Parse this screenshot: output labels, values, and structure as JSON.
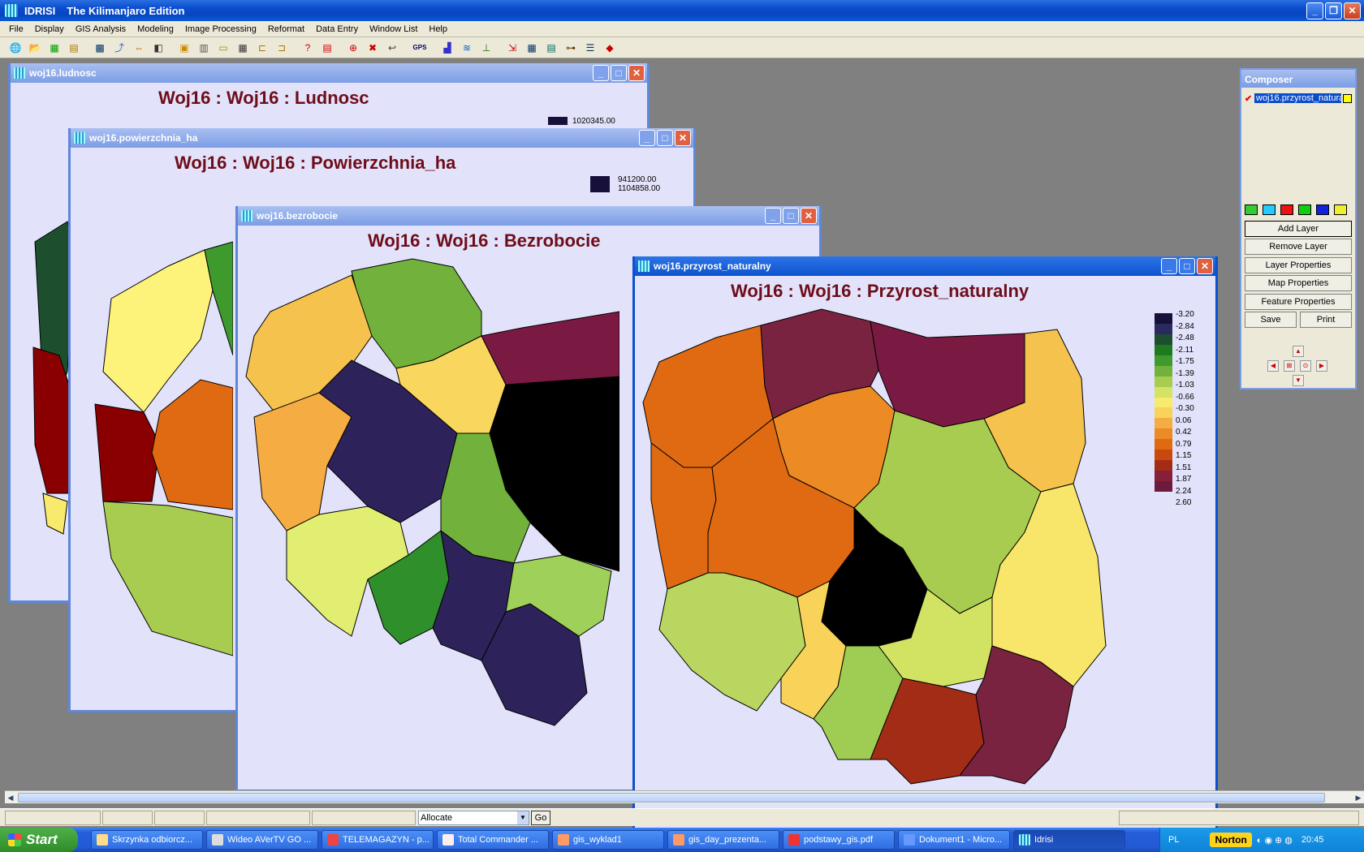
{
  "app": {
    "name": "IDRISI",
    "edition": "The Kilimanjaro Edition"
  },
  "menu": [
    "File",
    "Display",
    "GIS Analysis",
    "Modeling",
    "Image Processing",
    "Reformat",
    "Data Entry",
    "Window List",
    "Help"
  ],
  "toolbar": {
    "gps_label": "GPS"
  },
  "windows": {
    "ludnosc": {
      "title": "woj16.ludnosc",
      "map_title": "Woj16 : Woj16 : Ludnosc",
      "legend": [
        "1020345.00"
      ]
    },
    "powierzchnia": {
      "title": "woj16.powierzchnia_ha",
      "map_title": "Woj16 : Woj16 : Powierzchnia_ha",
      "legend": [
        "941200.00",
        "1104858.00"
      ]
    },
    "bezrobocie": {
      "title": "woj16.bezrobocie",
      "map_title": "Woj16 : Woj16 : Bezrobocie"
    },
    "przyrost": {
      "title": "woj16.przyrost_naturalny",
      "map_title": "Woj16 : Woj16 : Przyrost_naturalny",
      "legend": [
        "-3.20",
        "-2.84",
        "-2.48",
        "-2.11",
        "-1.75",
        "-1.39",
        "-1.03",
        "-0.66",
        "-0.30",
        "0.06",
        "0.42",
        "0.79",
        "1.15",
        "1.51",
        "1.87",
        "2.24",
        "2.60"
      ],
      "legend_colors": [
        "#16103a",
        "#2a2a60",
        "#1d4f2e",
        "#1f7a1f",
        "#3e9a2c",
        "#72b23c",
        "#a8cc50",
        "#d4e265",
        "#f7ea6c",
        "#f9d25a",
        "#f5ac42",
        "#ec8a24",
        "#e06a12",
        "#c8480e",
        "#a32c16",
        "#86203a",
        "#6e1a3c"
      ]
    }
  },
  "composer": {
    "title": "Composer",
    "layer": "woj16.przyrost_naturalny",
    "buttons": {
      "add_layer": "Add Layer",
      "remove_layer": "Remove Layer",
      "layer_properties": "Layer Properties",
      "map_properties": "Map Properties",
      "feature_properties": "Feature Properties",
      "save": "Save",
      "print": "Print"
    }
  },
  "status": {
    "allocate": "Allocate",
    "go": "Go"
  },
  "taskbar": {
    "start": "Start",
    "tasks": [
      {
        "label": "Skrzynka odbiorcz...",
        "active": false
      },
      {
        "label": "Wideo AVerTV GO ...",
        "active": false
      },
      {
        "label": "TELEMAGAZYN - p...",
        "active": false
      },
      {
        "label": "Total Commander ...",
        "active": false
      },
      {
        "label": "gis_wyklad1",
        "active": false
      },
      {
        "label": "gis_day_prezenta...",
        "active": false
      },
      {
        "label": "podstawy_gis.pdf",
        "active": false
      },
      {
        "label": "Dokument1 - Micro...",
        "active": false
      },
      {
        "label": "Idrisi",
        "active": true
      }
    ],
    "lang": "PL",
    "norton": "Norton",
    "clock": "20:45"
  }
}
